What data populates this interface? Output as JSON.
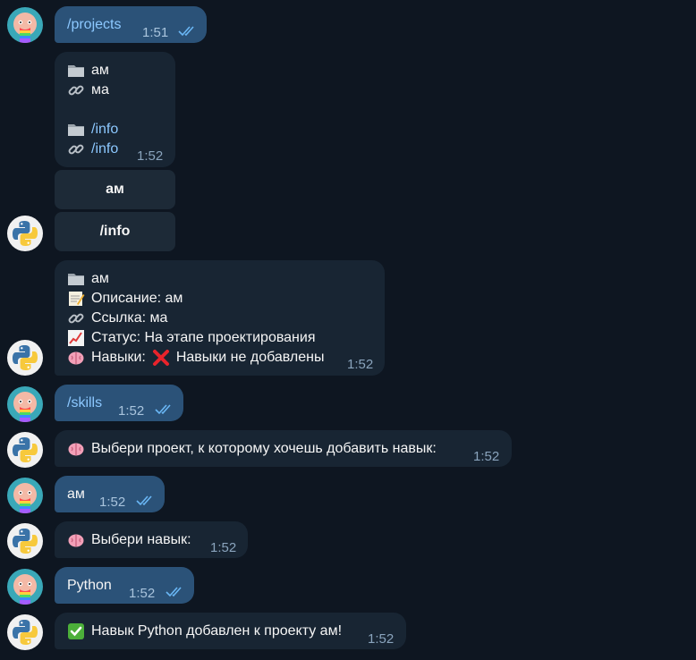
{
  "messages": [
    {
      "text": "/projects",
      "time": "1:51"
    },
    {
      "lines": [
        "ам",
        "ма",
        "",
        "/info",
        "/info"
      ],
      "time": "1:52"
    },
    {
      "buttons": [
        "ам",
        "/info"
      ]
    },
    {
      "lines": [
        "ам",
        "Описание: ам",
        "Ссылка: ма",
        "Статус: На этапе проектирования",
        "Навыки:",
        "Навыки не добавлены"
      ],
      "time": "1:52"
    },
    {
      "text": "/skills",
      "time": "1:52"
    },
    {
      "text": "Выбери проект, к которому хочешь добавить навык:",
      "time": "1:52"
    },
    {
      "text": "ам",
      "time": "1:52"
    },
    {
      "text": "Выбери навык:",
      "time": "1:52"
    },
    {
      "text": "Python",
      "time": "1:52"
    },
    {
      "text": "Навык Python добавлен к проекту ам!",
      "time": "1:52"
    }
  ],
  "colors": {
    "background": "#0e1621",
    "outgoing": "#2b5278",
    "incoming": "#182533",
    "command": "#8cc8ff"
  },
  "icons": [
    "folder-icon",
    "link-icon",
    "memo-icon",
    "chart-icon",
    "brain-icon",
    "cross-mark-icon",
    "check-mark-icon",
    "double-check-icon"
  ]
}
